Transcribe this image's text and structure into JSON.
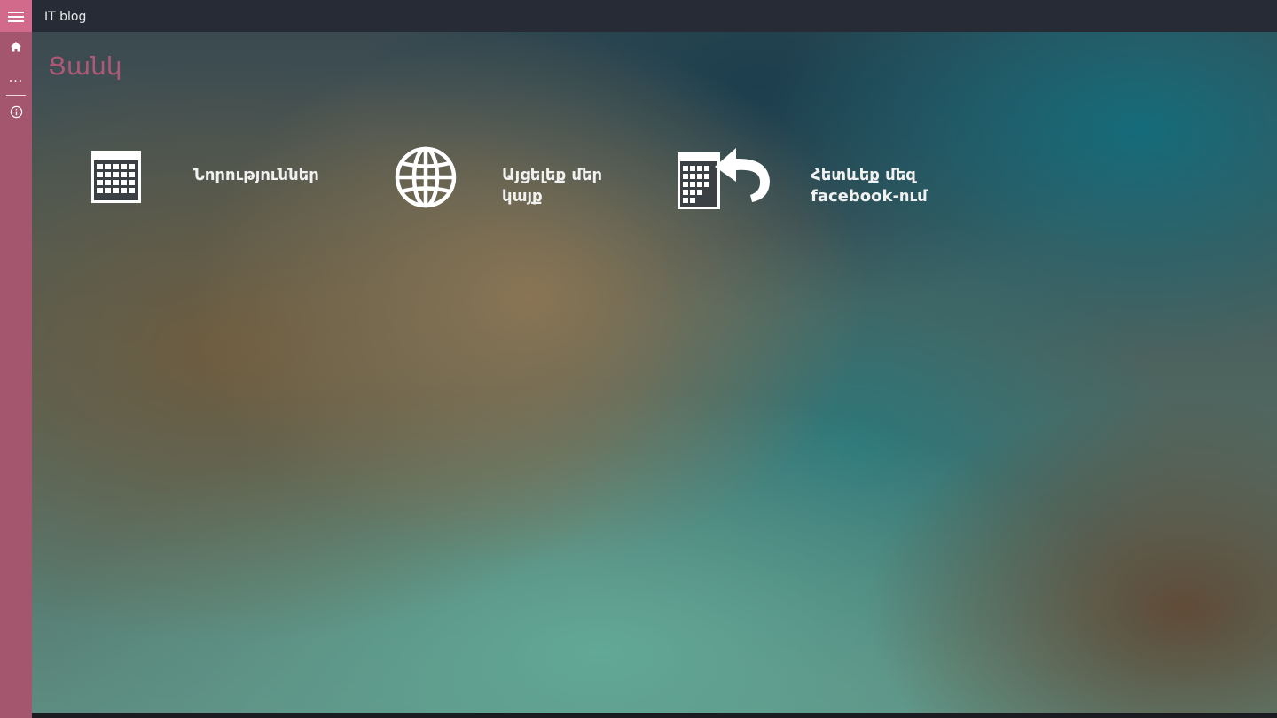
{
  "app": {
    "title": "IT blog"
  },
  "sidebar": {
    "items": [
      {
        "icon": "home-icon"
      },
      {
        "icon": "more-icon",
        "label": "..."
      },
      {
        "icon": "info-icon"
      }
    ]
  },
  "page": {
    "title": "Ցանկ"
  },
  "tiles": [
    {
      "label": "Նորություններ",
      "icon": "calendar-icon"
    },
    {
      "label": "Այցելեք մեր կայք",
      "icon": "globe-icon"
    },
    {
      "label": "Հետևեք մեզ facebook-ում",
      "icon": "share-calendar-icon"
    }
  ],
  "colors": {
    "accent": "#d26a8b",
    "rail": "#a5566f",
    "titlebar": "#272b35",
    "page_title": "#b05877"
  }
}
